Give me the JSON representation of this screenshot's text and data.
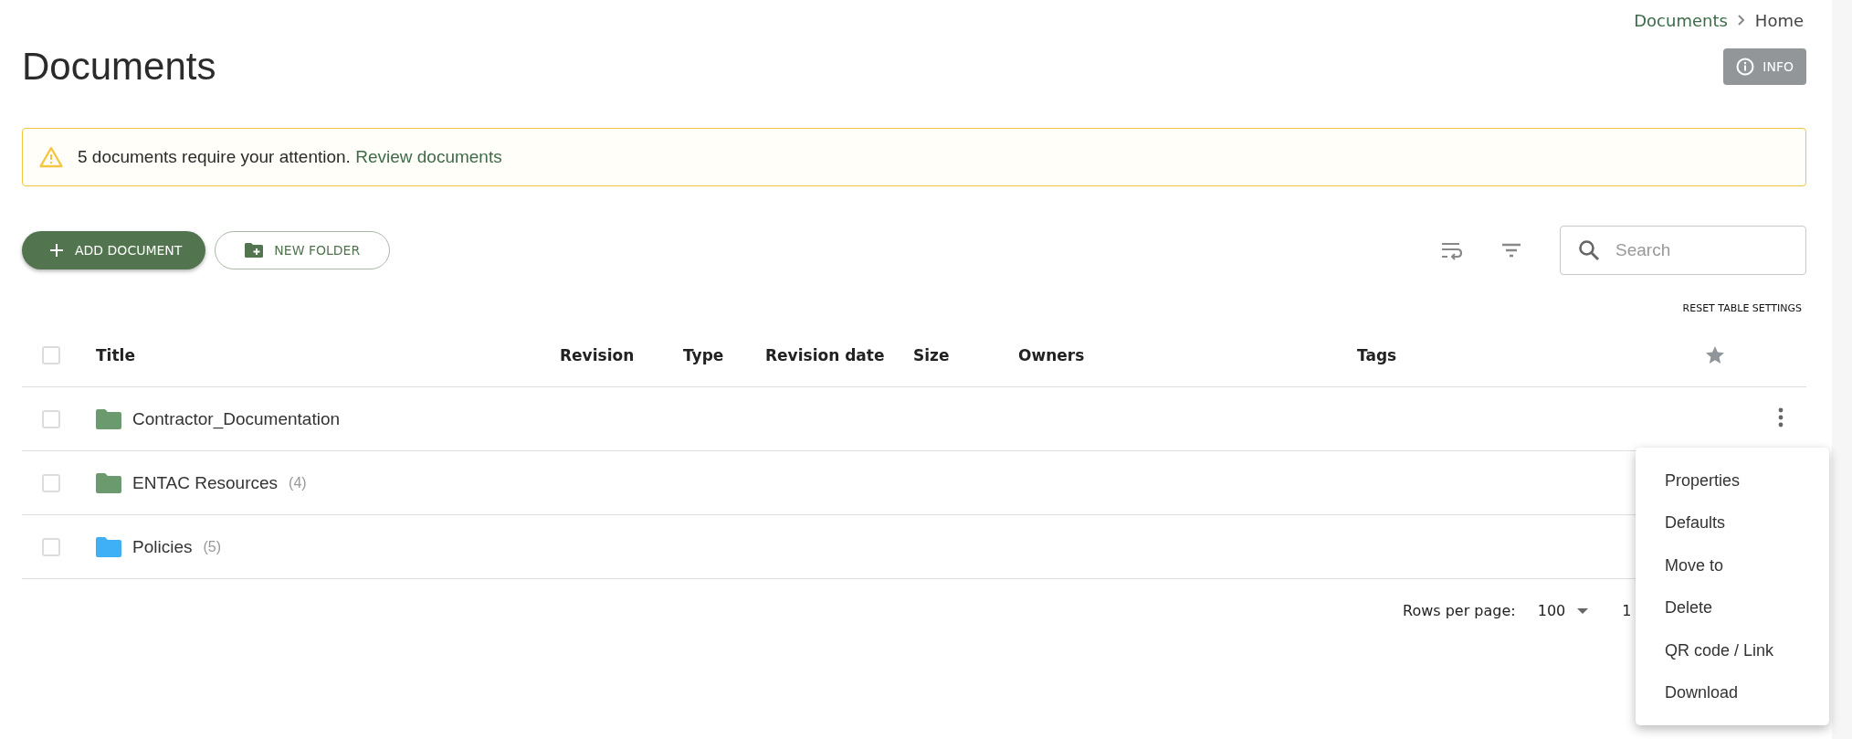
{
  "breadcrumb": [
    {
      "label": "Documents",
      "kind": "link"
    },
    {
      "label": "Home",
      "kind": "current"
    }
  ],
  "page_title": "Documents",
  "info_button": "INFO",
  "alert": {
    "message": "5 documents require your attention.",
    "link": "Review documents"
  },
  "buttons": [
    {
      "label": "ADD DOCUMENT",
      "kind": "primary"
    },
    {
      "label": "NEW FOLDER",
      "kind": "outlined"
    }
  ],
  "search": {
    "placeholder": "Search"
  },
  "reset_table_settings": "RESET TABLE SETTINGS",
  "table": {
    "select_all_checked": false,
    "columns": [
      "Title",
      "Revision",
      "Type",
      "Revision date",
      "Size",
      "Owners",
      "Tags"
    ],
    "rows": [
      {
        "title": "Contractor_Documentation",
        "checked": false,
        "color": "#6b9a6f",
        "actions_shown": true
      },
      {
        "title": "ENTAC Resources",
        "count": "(4)",
        "checked": false,
        "color": "#6b9a6f",
        "actions_shown": false
      },
      {
        "title": "Policies",
        "count": "(5)",
        "checked": false,
        "color": "#3fb0f5",
        "actions_shown": false
      }
    ]
  },
  "pagination": {
    "rows_per_page_label": "Rows per page:",
    "rows_per_page": "100",
    "range": "1"
  },
  "context_menu": [
    "Properties",
    "Defaults",
    "Move to",
    "Delete",
    "QR code / Link",
    "Download"
  ]
}
